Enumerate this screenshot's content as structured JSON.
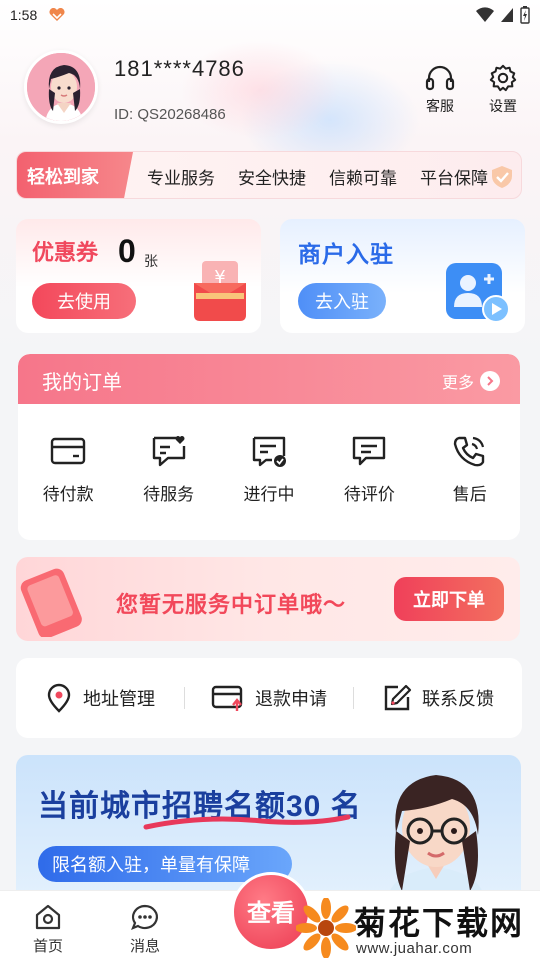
{
  "status_bar": {
    "time": "1:58"
  },
  "profile": {
    "phone": "181****4786",
    "id": "ID: QS20268486"
  },
  "top_actions": {
    "service": "客服",
    "settings": "设置"
  },
  "strip": {
    "tag": "轻松到家",
    "items": [
      "专业服务",
      "安全快捷",
      "信赖可靠",
      "平台保障"
    ]
  },
  "coupon": {
    "title": "优惠券",
    "count": "0",
    "unit": "张",
    "button": "去使用"
  },
  "merchant": {
    "title": "商户入驻",
    "button": "去入驻"
  },
  "orders": {
    "title": "我的订单",
    "more": "更多",
    "items": [
      "待付款",
      "待服务",
      "进行中",
      "待评价",
      "售后"
    ]
  },
  "empty_banner": {
    "message": "您暂无服务中订单哦～",
    "button": "立即下单"
  },
  "tools": [
    "地址管理",
    "退款申请",
    "联系反馈"
  ],
  "recruit": {
    "title": "当前城市招聘名额30 名",
    "subtitle": "限名额入驻，单量有保障"
  },
  "bottom_nav": {
    "home": "首页",
    "messages": "消息",
    "fab": "查看"
  },
  "watermark": {
    "name": "菊花下载网",
    "url": "www.juahar.com"
  },
  "colors": {
    "primary_red": "#f0485d",
    "primary_blue": "#2a6ae8",
    "pink_header": "#f6768a"
  }
}
